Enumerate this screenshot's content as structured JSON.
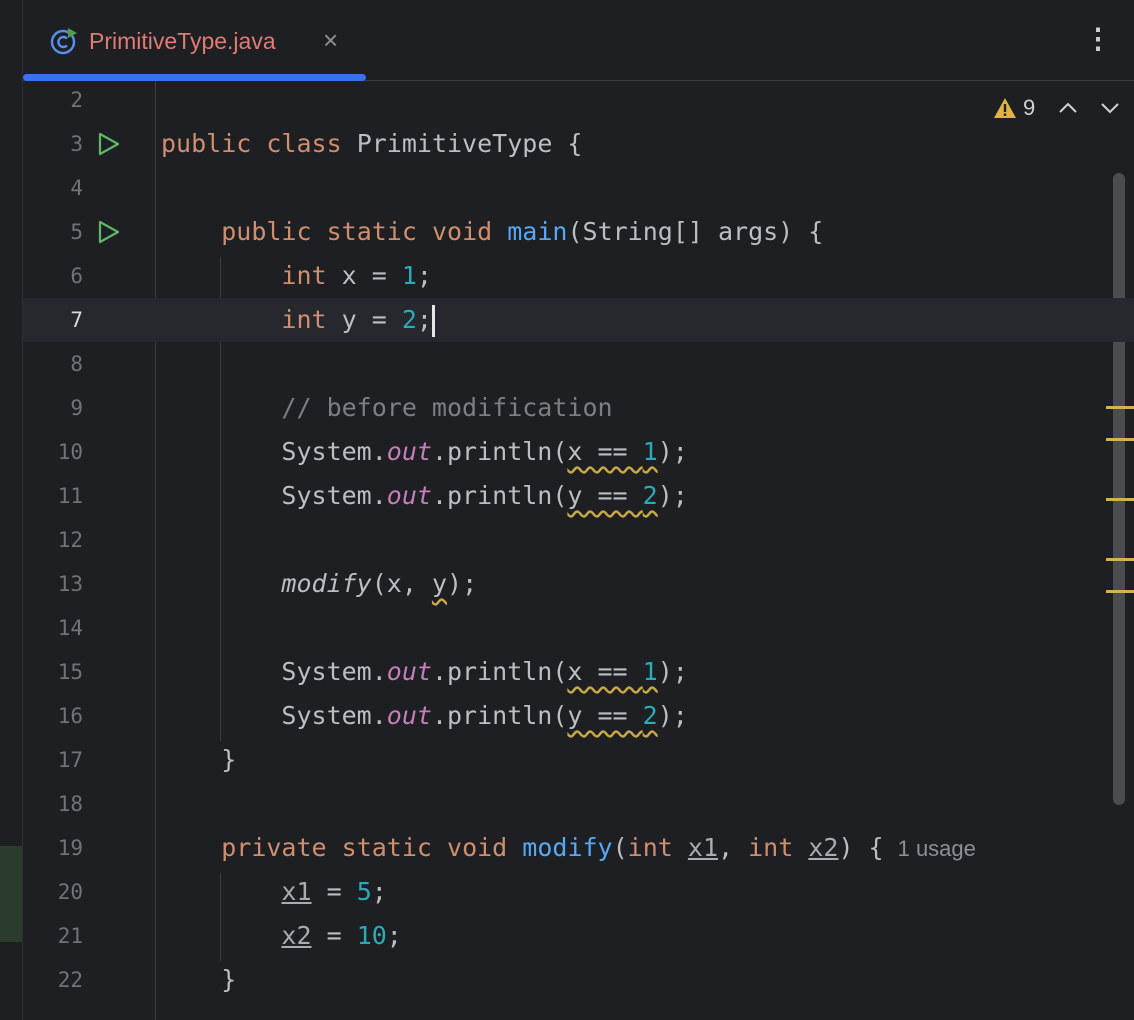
{
  "tab": {
    "filename": "PrimitiveType.java",
    "close_glyph": "×",
    "more_glyph": "⋮",
    "accent_color": "#3574f0",
    "filename_color": "#e07a73"
  },
  "inspections": {
    "warning_count": "9"
  },
  "editor": {
    "current_line": 7,
    "lines": [
      {
        "n": "2"
      },
      {
        "n": "3",
        "run": true
      },
      {
        "n": "4"
      },
      {
        "n": "5",
        "run": true
      },
      {
        "n": "6"
      },
      {
        "n": "7"
      },
      {
        "n": "8"
      },
      {
        "n": "9"
      },
      {
        "n": "10"
      },
      {
        "n": "11"
      },
      {
        "n": "12"
      },
      {
        "n": "13"
      },
      {
        "n": "14"
      },
      {
        "n": "15"
      },
      {
        "n": "16"
      },
      {
        "n": "17"
      },
      {
        "n": "18"
      },
      {
        "n": "19"
      },
      {
        "n": "20"
      },
      {
        "n": "21"
      },
      {
        "n": "22"
      }
    ],
    "tokens": {
      "public": "public",
      "class": "class",
      "classname": "PrimitiveType",
      "open_brace": " {",
      "static": "static",
      "void": "void",
      "main": "main",
      "main_params": "(String[] args) {",
      "int": "int",
      "x_decl": " x = ",
      "y_decl": " y = ",
      "one": "1",
      "two": "2",
      "semi": ";",
      "comment": "// before modification",
      "system": "System.",
      "out": "out",
      "println_open": ".println(",
      "x_eq": "x == ",
      "y_eq": "y == ",
      "close_call": ");",
      "modify": "modify",
      "modify_call_open": "(x, ",
      "y_arg": "y",
      "close_brace": "}",
      "private": "private",
      "modify_params_open": "(",
      "x1": "x1",
      "x2": "x2",
      "comma": ", ",
      "modify_params_close": ") {",
      "usage_hint": "1 usage",
      "assign": " = ",
      "five": "5",
      "ten": "10"
    }
  }
}
